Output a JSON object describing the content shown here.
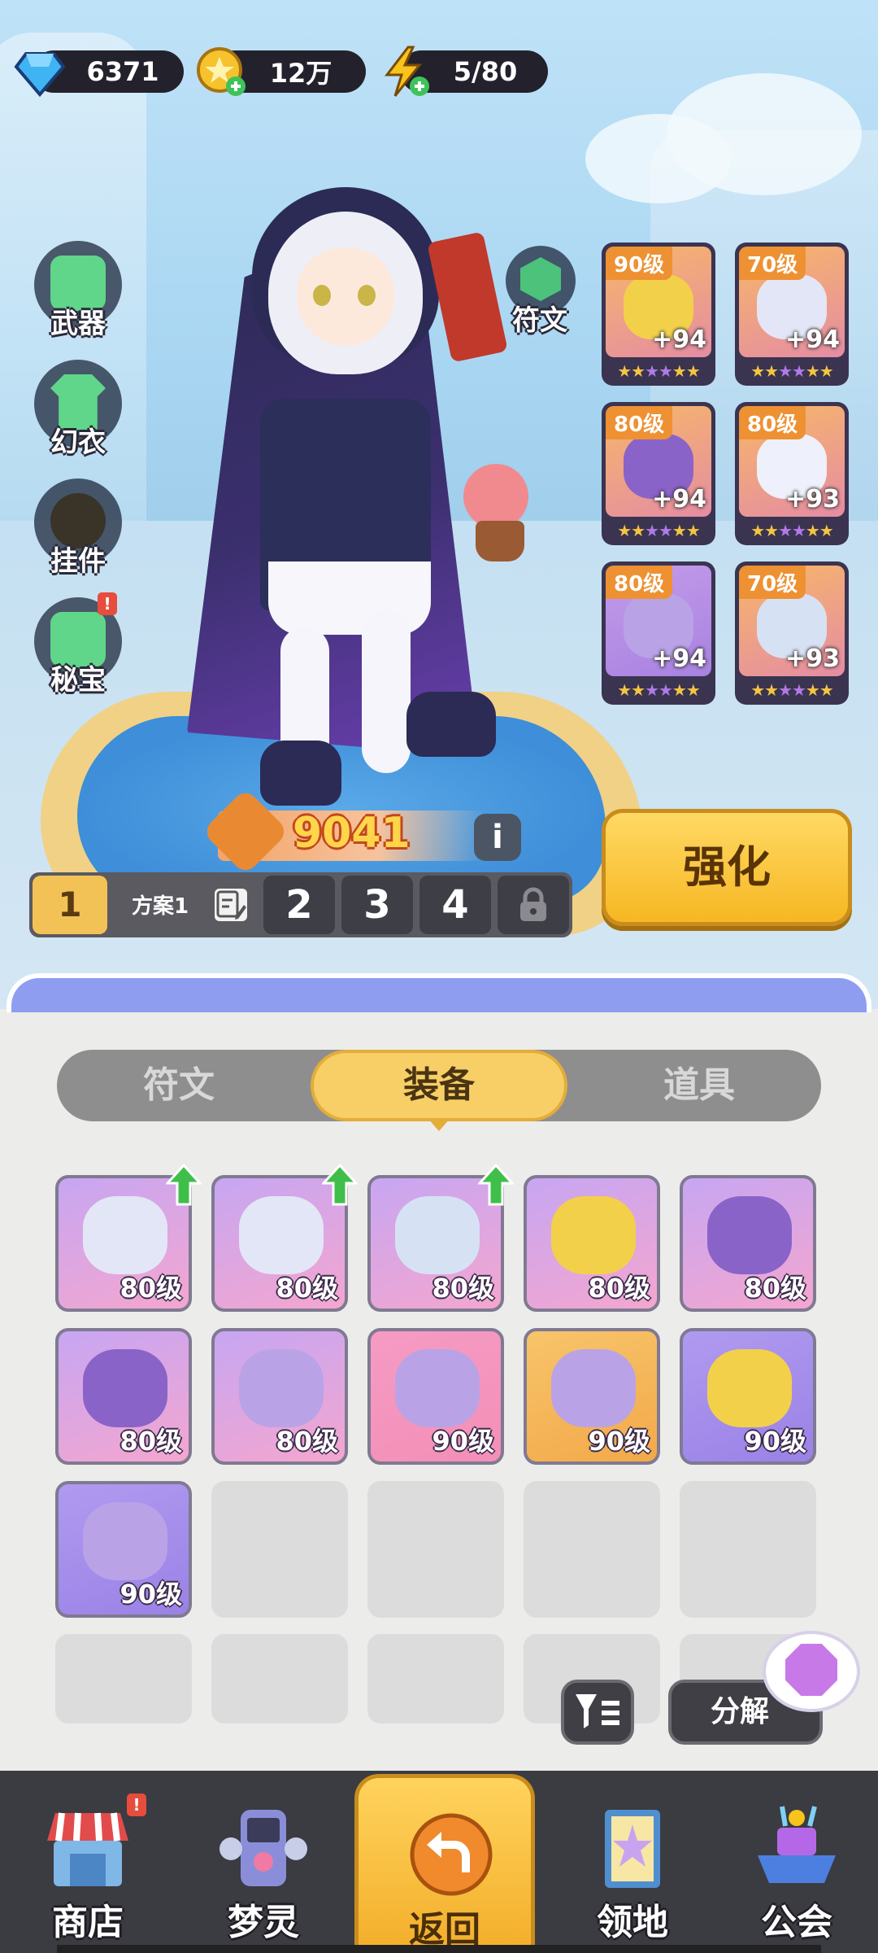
{
  "resources": {
    "diamonds": "6371",
    "gold": "12万",
    "energy": "5/80"
  },
  "side_menu": {
    "weapon": "武器",
    "outfit": "幻衣",
    "pendant": "挂件",
    "treasure": "秘宝",
    "treasure_badge": "!"
  },
  "rune_button": "符文",
  "equipped": [
    {
      "level": "90级",
      "bonus": "+94",
      "item": "helmet",
      "bg": [
        "#f7b768",
        "#e58ca4"
      ]
    },
    {
      "level": "70级",
      "bonus": "+94",
      "item": "armor",
      "bg": [
        "#f7b768",
        "#e58ca4"
      ]
    },
    {
      "level": "80级",
      "bonus": "+94",
      "item": "bracer",
      "bg": [
        "#f7b768",
        "#e58ca4"
      ]
    },
    {
      "level": "80级",
      "bonus": "+93",
      "item": "pants",
      "bg": [
        "#f7b768",
        "#e58ca4"
      ]
    },
    {
      "level": "80级",
      "bonus": "+94",
      "item": "boots",
      "bg": [
        "#c49bea",
        "#a782e0"
      ]
    },
    {
      "level": "70级",
      "bonus": "+93",
      "item": "orb",
      "bg": [
        "#f7b768",
        "#e58ca4"
      ]
    }
  ],
  "combat_power": "9041",
  "info_label": "i",
  "presets": {
    "active_number": "1",
    "active_name": "方案1",
    "others": [
      "2",
      "3",
      "4"
    ]
  },
  "strengthen_label": "强化",
  "tabs": {
    "rune": "符文",
    "equipment": "装备",
    "items": "道具",
    "active": "equipment"
  },
  "inventory": [
    {
      "level": "80级",
      "item": "armor",
      "upgrade": true,
      "bg": [
        "#c7a6f2",
        "#f4a6cf"
      ]
    },
    {
      "level": "80级",
      "item": "armor",
      "upgrade": true,
      "bg": [
        "#c7a6f2",
        "#f4a6cf"
      ]
    },
    {
      "level": "80级",
      "item": "orb",
      "upgrade": true,
      "bg": [
        "#c7a6f2",
        "#f4a6cf"
      ]
    },
    {
      "level": "80级",
      "item": "helmet",
      "upgrade": false,
      "bg": [
        "#c7a6f2",
        "#f4a6cf"
      ]
    },
    {
      "level": "80级",
      "item": "bracer",
      "upgrade": false,
      "bg": [
        "#c7a6f2",
        "#f4a6cf"
      ]
    },
    {
      "level": "80级",
      "item": "bracer",
      "upgrade": false,
      "bg": [
        "#c7a6f2",
        "#f4a6cf"
      ]
    },
    {
      "level": "80级",
      "item": "boots",
      "upgrade": false,
      "bg": [
        "#c7a6f2",
        "#f4a6cf"
      ]
    },
    {
      "level": "90级",
      "item": "boots",
      "upgrade": false,
      "bg": [
        "#f59bc4",
        "#f48fb6"
      ]
    },
    {
      "level": "90级",
      "item": "boots",
      "upgrade": false,
      "bg": [
        "#f8c46a",
        "#f2a94a"
      ]
    },
    {
      "level": "90级",
      "item": "helmet",
      "upgrade": false,
      "bg": [
        "#b09af0",
        "#9a82e6"
      ]
    },
    {
      "level": "90级",
      "item": "boots",
      "upgrade": false,
      "bg": [
        "#b09af0",
        "#9a82e6"
      ]
    }
  ],
  "decompose_label": "分解",
  "bottom_nav": {
    "shop": "商店",
    "shop_badge": "!",
    "dream_spirit": "梦灵",
    "back": "返回",
    "territory": "领地",
    "guild": "公会"
  },
  "colors": {
    "gold_button": "#f6b722",
    "tab_active": "#f7cf66",
    "power_text": "#ffd54a"
  }
}
